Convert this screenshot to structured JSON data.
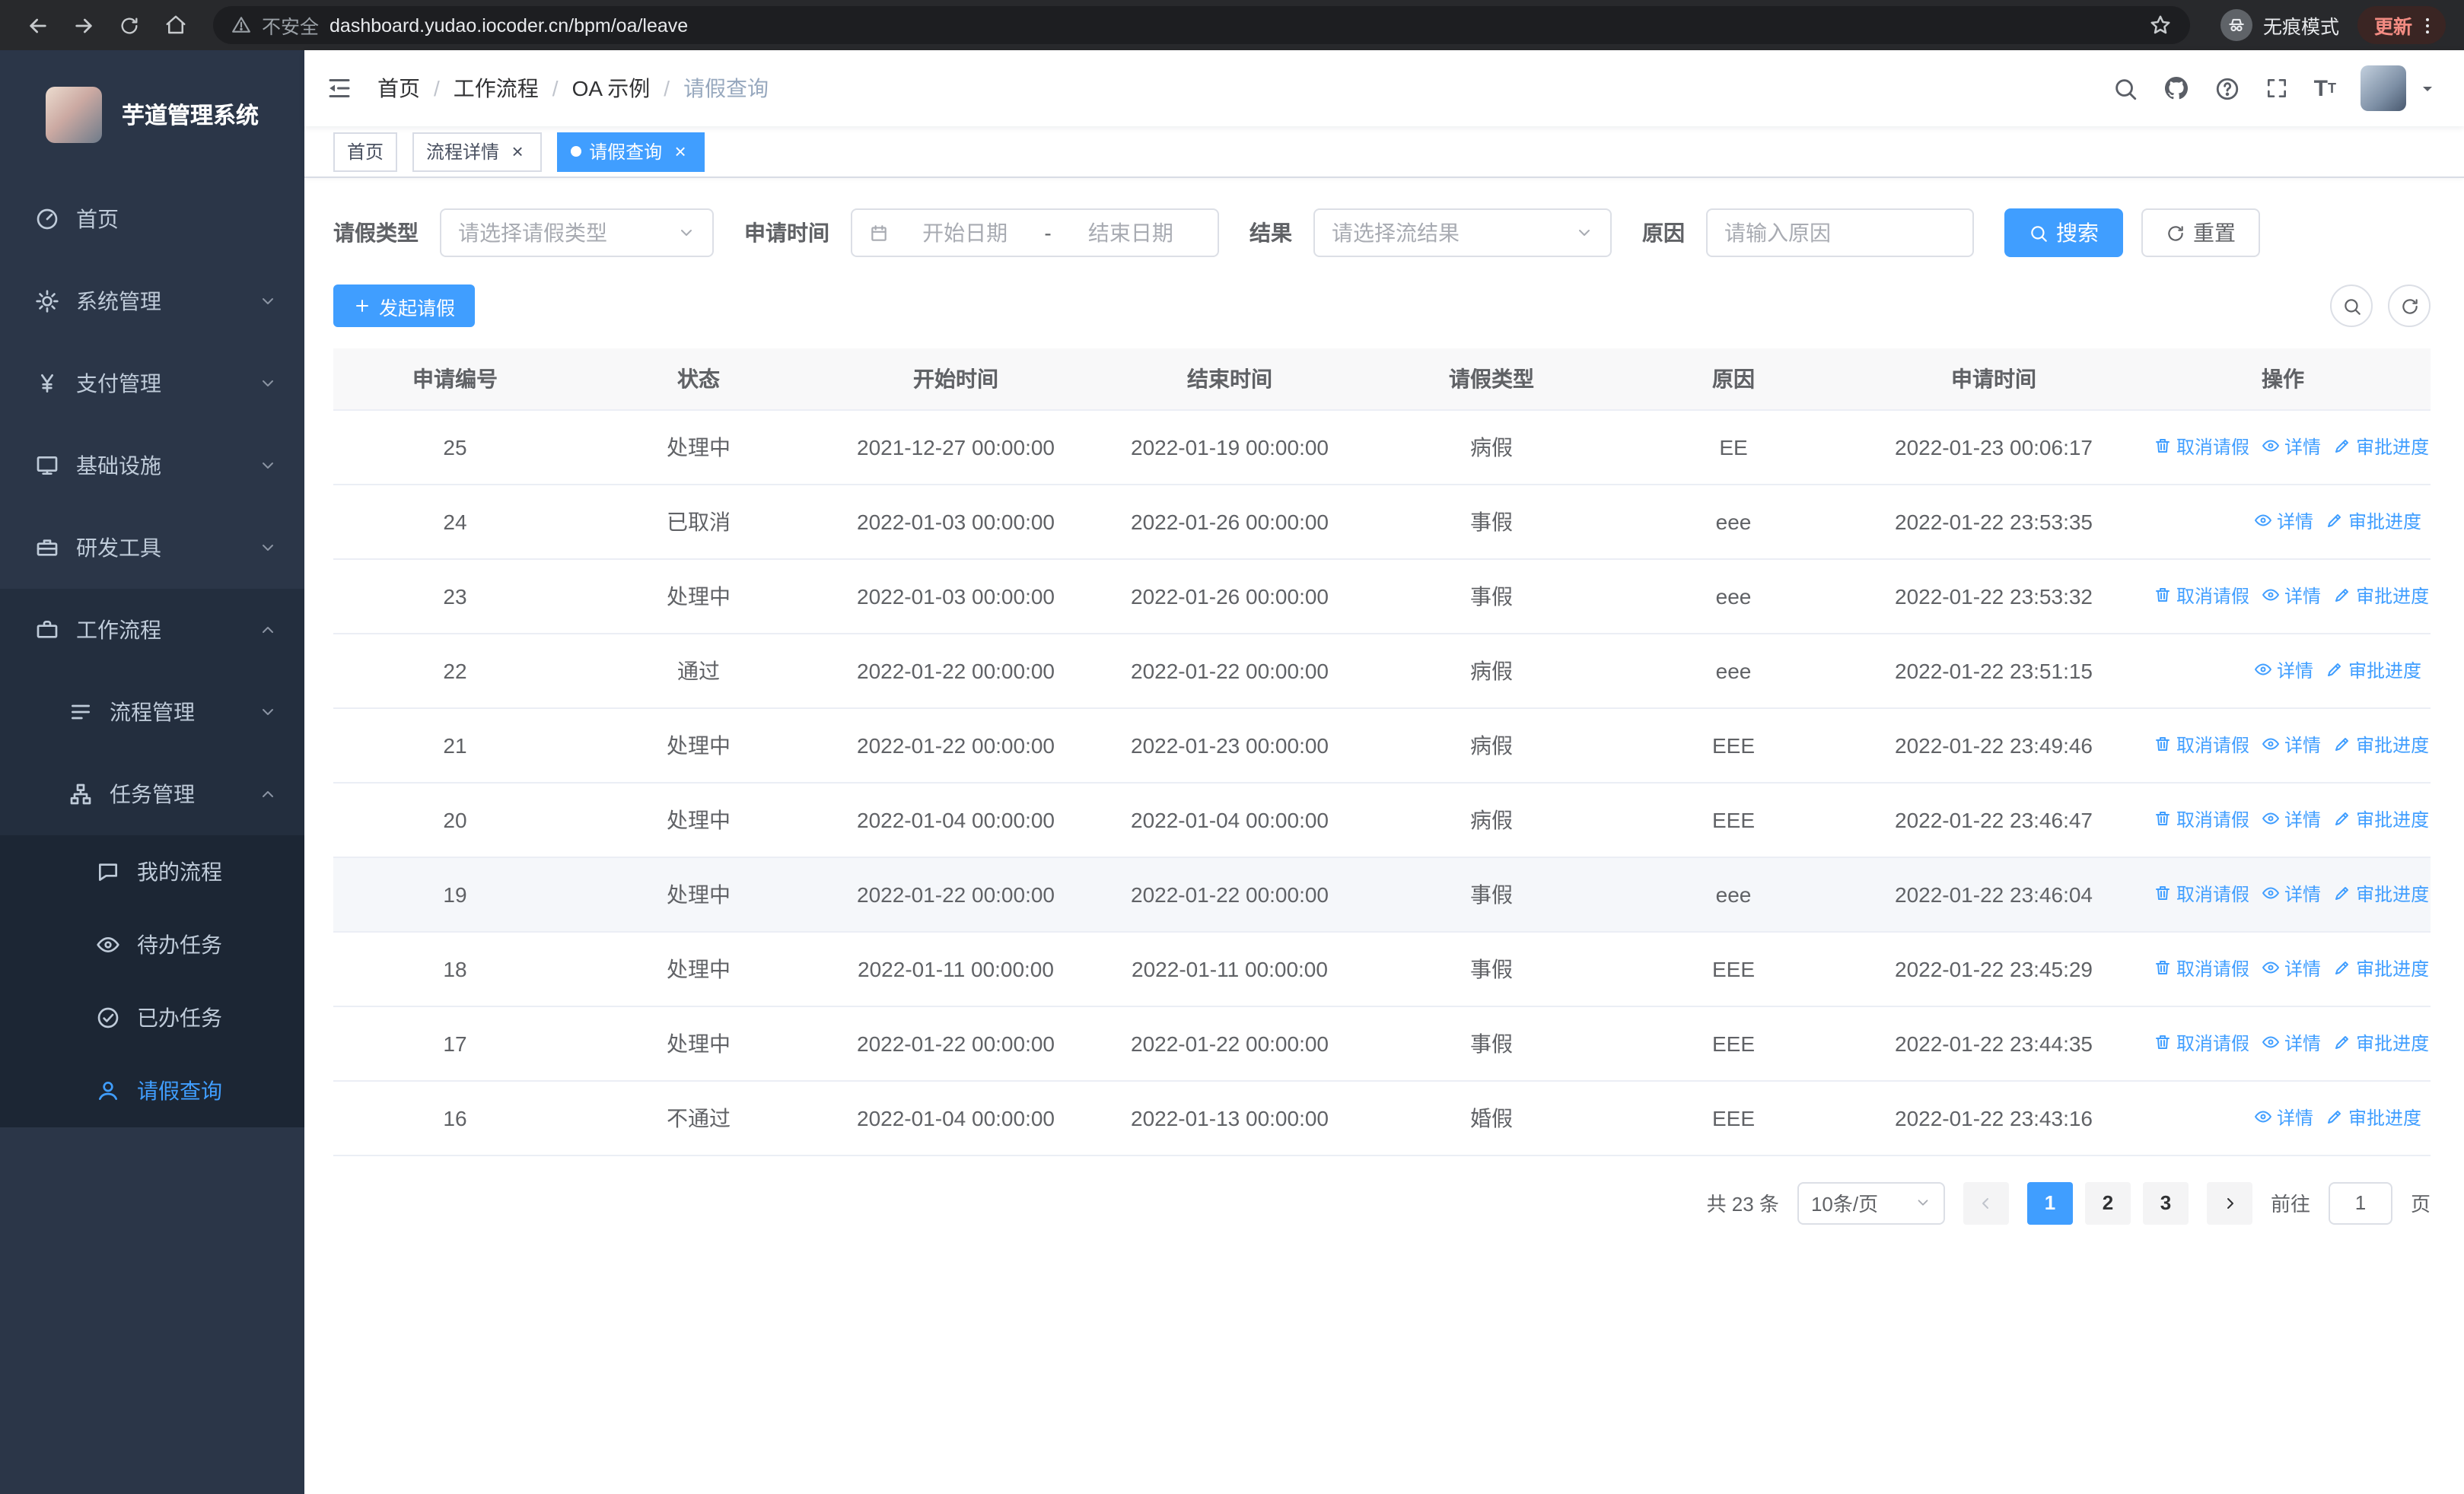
{
  "theme": {
    "accent": "#409eff",
    "chrome_bg": "#28292c",
    "sidebar_bg": "#2b3648",
    "sidebar_submenu_bg": "#232e3e",
    "sidebar_leaf_bg": "#1c2634"
  },
  "browser": {
    "security_label": "不安全",
    "url": "dashboard.yudao.iocoder.cn/bpm/oa/leave",
    "incognito_label": "无痕模式",
    "update_label": "更新"
  },
  "sidebar": {
    "app_title": "芋道管理系统",
    "menu": [
      {
        "name": "home",
        "label": "首页",
        "icon": "dashboard",
        "level": 1
      },
      {
        "name": "system-management",
        "label": "系统管理",
        "icon": "gear",
        "level": 1,
        "arrow": "down"
      },
      {
        "name": "payment-management",
        "label": "支付管理",
        "icon": "yen",
        "level": 1,
        "arrow": "down"
      },
      {
        "name": "infrastructure",
        "label": "基础设施",
        "icon": "monitor",
        "level": 1,
        "arrow": "down"
      },
      {
        "name": "dev-tools",
        "label": "研发工具",
        "icon": "toolbox",
        "level": 1,
        "arrow": "down"
      },
      {
        "name": "workflow",
        "label": "工作流程",
        "icon": "briefcase",
        "level": 1,
        "arrow": "up",
        "group": true
      },
      {
        "name": "process-management",
        "label": "流程管理",
        "icon": "flow",
        "level": 2,
        "arrow": "down"
      },
      {
        "name": "task-management",
        "label": "任务管理",
        "icon": "tree",
        "level": 2,
        "arrow": "up"
      },
      {
        "name": "my-process",
        "label": "我的流程",
        "icon": "chat",
        "level": 3
      },
      {
        "name": "todo-tasks",
        "label": "待办任务",
        "icon": "eye",
        "level": 3
      },
      {
        "name": "done-tasks",
        "label": "已办任务",
        "icon": "check-circle",
        "level": 3
      },
      {
        "name": "leave-query",
        "label": "请假查询",
        "icon": "user",
        "level": 3,
        "active": true
      }
    ]
  },
  "navbar": {
    "breadcrumb": [
      "首页",
      "工作流程",
      "OA 示例",
      "请假查询"
    ]
  },
  "tags": [
    {
      "name": "home",
      "label": "首页",
      "closable": false,
      "active": false
    },
    {
      "name": "process-detail",
      "label": "流程详情",
      "closable": true,
      "active": false
    },
    {
      "name": "leave-query",
      "label": "请假查询",
      "closable": true,
      "active": true
    }
  ],
  "filters": {
    "leave_type_label": "请假类型",
    "leave_type_placeholder": "请选择请假类型",
    "apply_time_label": "申请时间",
    "start_date_placeholder": "开始日期",
    "range_separator": "-",
    "end_date_placeholder": "结束日期",
    "result_label": "结果",
    "result_placeholder": "请选择流结果",
    "reason_label": "原因",
    "reason_placeholder": "请输入原因",
    "search_button": "搜索",
    "reset_button": "重置"
  },
  "toolbar": {
    "create_label": "发起请假"
  },
  "table": {
    "headers": [
      "申请编号",
      "状态",
      "开始时间",
      "结束时间",
      "请假类型",
      "原因",
      "申请时间",
      "操作"
    ],
    "action_labels": {
      "cancel": "取消请假",
      "detail": "详情",
      "progress": "审批进度"
    },
    "rows": [
      {
        "no": "25",
        "status": "处理中",
        "start": "2021-12-27 00:00:00",
        "end": "2022-01-19 00:00:00",
        "type": "病假",
        "reason": "EE",
        "apply_time": "2022-01-23 00:06:17",
        "actions": [
          "cancel",
          "detail",
          "progress"
        ],
        "highlighted": false
      },
      {
        "no": "24",
        "status": "已取消",
        "start": "2022-01-03 00:00:00",
        "end": "2022-01-26 00:00:00",
        "type": "事假",
        "reason": "eee",
        "apply_time": "2022-01-22 23:53:35",
        "actions": [
          "detail",
          "progress"
        ],
        "highlighted": false
      },
      {
        "no": "23",
        "status": "处理中",
        "start": "2022-01-03 00:00:00",
        "end": "2022-01-26 00:00:00",
        "type": "事假",
        "reason": "eee",
        "apply_time": "2022-01-22 23:53:32",
        "actions": [
          "cancel",
          "detail",
          "progress"
        ],
        "highlighted": false
      },
      {
        "no": "22",
        "status": "通过",
        "start": "2022-01-22 00:00:00",
        "end": "2022-01-22 00:00:00",
        "type": "病假",
        "reason": "eee",
        "apply_time": "2022-01-22 23:51:15",
        "actions": [
          "detail",
          "progress"
        ],
        "highlighted": false
      },
      {
        "no": "21",
        "status": "处理中",
        "start": "2022-01-22 00:00:00",
        "end": "2022-01-23 00:00:00",
        "type": "病假",
        "reason": "EEE",
        "apply_time": "2022-01-22 23:49:46",
        "actions": [
          "cancel",
          "detail",
          "progress"
        ],
        "highlighted": false
      },
      {
        "no": "20",
        "status": "处理中",
        "start": "2022-01-04 00:00:00",
        "end": "2022-01-04 00:00:00",
        "type": "病假",
        "reason": "EEE",
        "apply_time": "2022-01-22 23:46:47",
        "actions": [
          "cancel",
          "detail",
          "progress"
        ],
        "highlighted": false
      },
      {
        "no": "19",
        "status": "处理中",
        "start": "2022-01-22 00:00:00",
        "end": "2022-01-22 00:00:00",
        "type": "事假",
        "reason": "eee",
        "apply_time": "2022-01-22 23:46:04",
        "actions": [
          "cancel",
          "detail",
          "progress"
        ],
        "highlighted": true
      },
      {
        "no": "18",
        "status": "处理中",
        "start": "2022-01-11 00:00:00",
        "end": "2022-01-11 00:00:00",
        "type": "事假",
        "reason": "EEE",
        "apply_time": "2022-01-22 23:45:29",
        "actions": [
          "cancel",
          "detail",
          "progress"
        ],
        "highlighted": false
      },
      {
        "no": "17",
        "status": "处理中",
        "start": "2022-01-22 00:00:00",
        "end": "2022-01-22 00:00:00",
        "type": "事假",
        "reason": "EEE",
        "apply_time": "2022-01-22 23:44:35",
        "actions": [
          "cancel",
          "detail",
          "progress"
        ],
        "highlighted": false
      },
      {
        "no": "16",
        "status": "不通过",
        "start": "2022-01-04 00:00:00",
        "end": "2022-01-13 00:00:00",
        "type": "婚假",
        "reason": "EEE",
        "apply_time": "2022-01-22 23:43:16",
        "actions": [
          "detail",
          "progress"
        ],
        "highlighted": false
      }
    ]
  },
  "pagination": {
    "total_label": "共 23 条",
    "page_size_label": "10条/页",
    "pages": [
      "1",
      "2",
      "3"
    ],
    "active_page": "1",
    "goto_prefix": "前往",
    "goto_value": "1",
    "goto_suffix": "页"
  }
}
